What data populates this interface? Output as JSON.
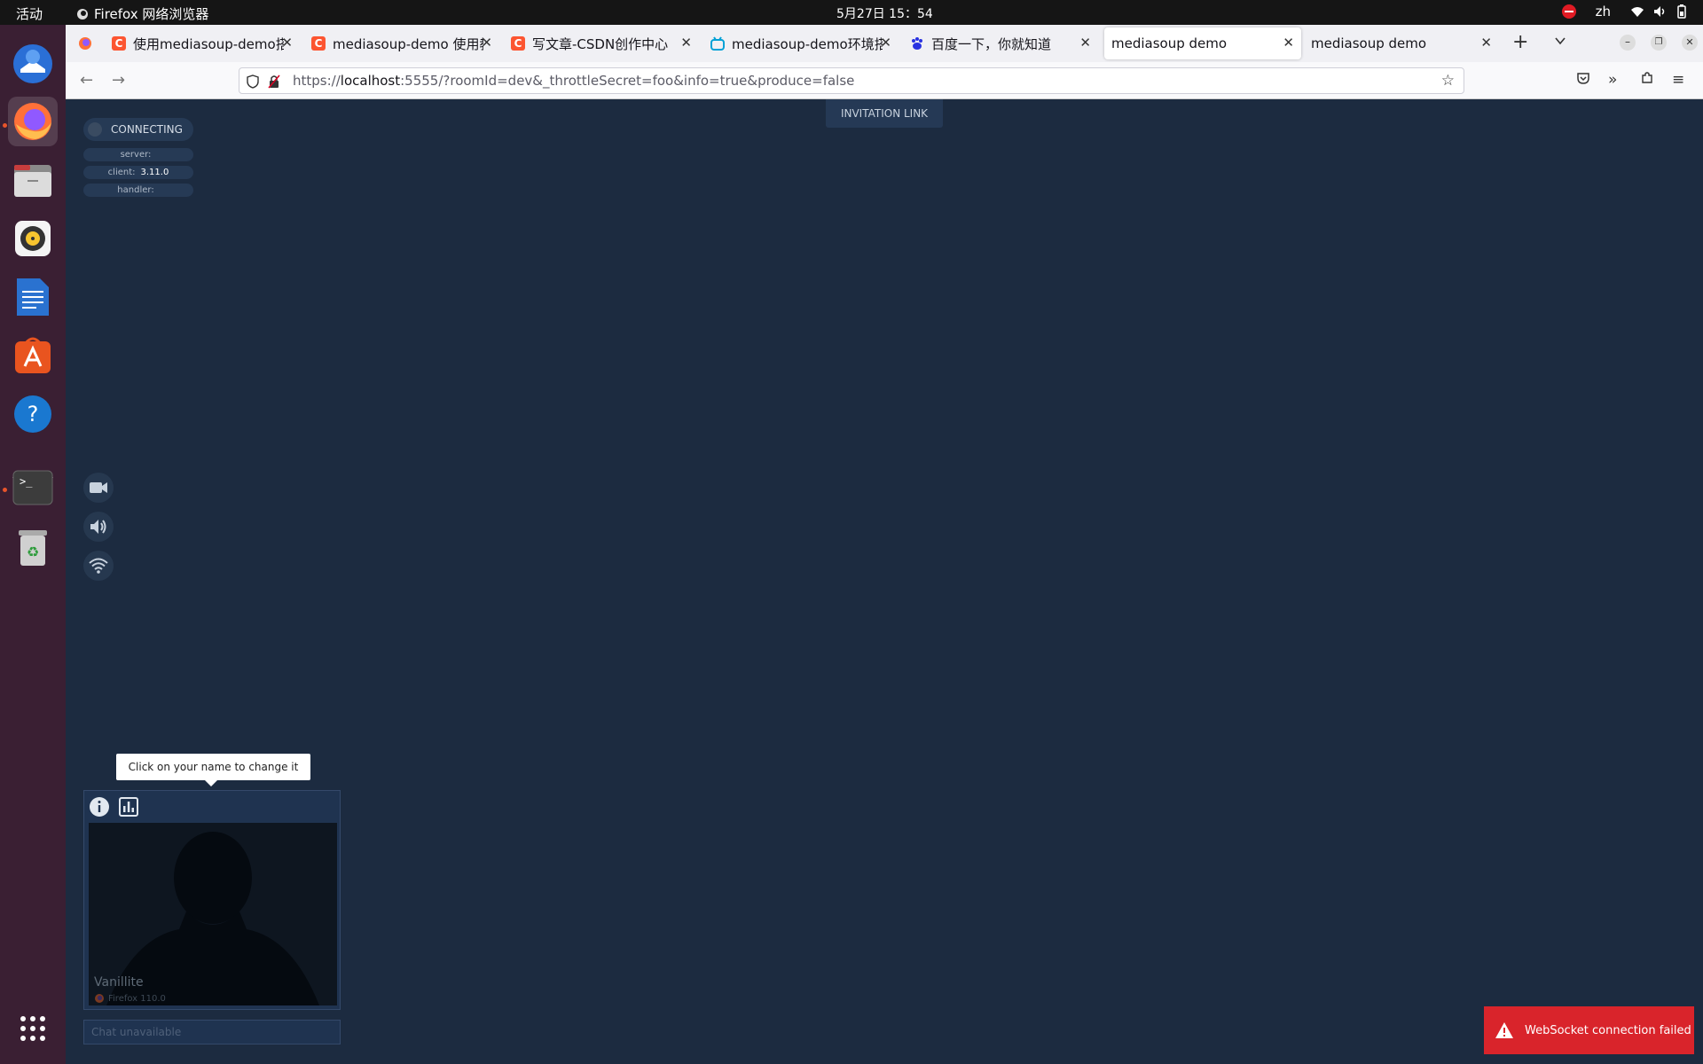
{
  "system": {
    "activities": "活动",
    "app_name": "Firefox 网络浏览器",
    "clock": "5月27日  15：54",
    "input_method": "zh"
  },
  "tabs": [
    {
      "title": "使用mediasoup-demo搭建",
      "favicon": "csdn-icon"
    },
    {
      "title": "mediasoup-demo 使用教程",
      "favicon": "csdn-icon"
    },
    {
      "title": "写文章-CSDN创作中心",
      "favicon": "csdn-icon"
    },
    {
      "title": "mediasoup-demo环境搭建",
      "favicon": "bilibili-icon"
    },
    {
      "title": "百度一下，你就知道",
      "favicon": "baidu-icon"
    },
    {
      "title": "mediasoup demo",
      "favicon": "none"
    },
    {
      "title": "mediasoup demo",
      "favicon": "none"
    }
  ],
  "url": {
    "scheme": "https://",
    "host": "localhost",
    "rest": ":5555/?roomId=dev&_throttleSecret=foo&info=true&produce=false"
  },
  "room": {
    "invitation_label": "INVITATION LINK",
    "state": "CONNECTING",
    "server_label": "server:",
    "server_value": "",
    "client_label": "client:",
    "client_value": "3.11.0",
    "handler_label": "handler:",
    "handler_value": ""
  },
  "me": {
    "tooltip": "Click on your name to change it",
    "display_name": "Vanillite",
    "device": "Firefox 110.0",
    "chat_placeholder": "Chat unavailable"
  },
  "notification": {
    "text": "WebSocket connection failed"
  },
  "colors": {
    "page_bg": "#1c2b40",
    "error_red": "#d9242b",
    "dock_bg": "#3a1f33"
  }
}
